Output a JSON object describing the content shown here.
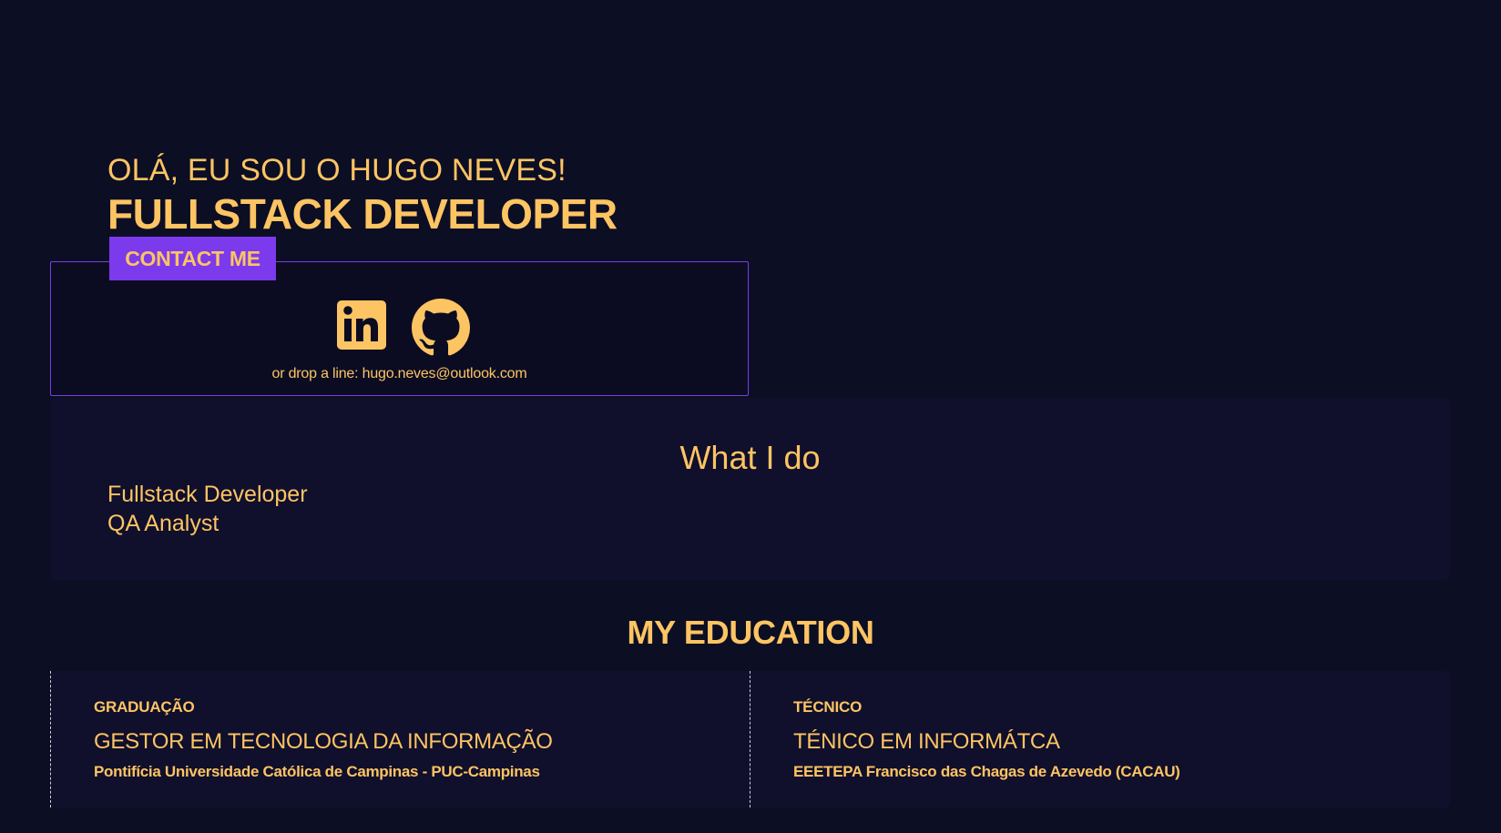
{
  "hero": {
    "greeting": "OLÁ, EU SOU O HUGO NEVES!",
    "role": "FULLSTACK DEVELOPER"
  },
  "contact": {
    "button_label": "CONTACT ME",
    "socials": [
      {
        "name": "linkedin",
        "icon": "linkedin-icon"
      },
      {
        "name": "github",
        "icon": "github-icon"
      }
    ],
    "drop_line_prefix": "or drop a line: ",
    "email": "hugo.neves@outlook.com"
  },
  "what_i_do": {
    "title": "What I do",
    "items": [
      "Fullstack Developer",
      "QA Analyst"
    ]
  },
  "education": {
    "title": "MY EDUCATION",
    "entries": [
      {
        "type": "GRADUAÇÃO",
        "course": "GESTOR EM TECNOLOGIA DA INFORMAÇÃO",
        "school": "Pontifícia Universidade Católica de Campinas - PUC-Campinas"
      },
      {
        "type": "TÉCNICO",
        "course": "TÉNICO EM INFORMÁTCA",
        "school": "EEETEPA Francisco das Chagas de Azevedo (CACAU)"
      }
    ]
  },
  "colors": {
    "background": "#0c0e24",
    "accent_text": "#fdc463",
    "purple": "#7c3aed",
    "panel": "#100f2c"
  }
}
